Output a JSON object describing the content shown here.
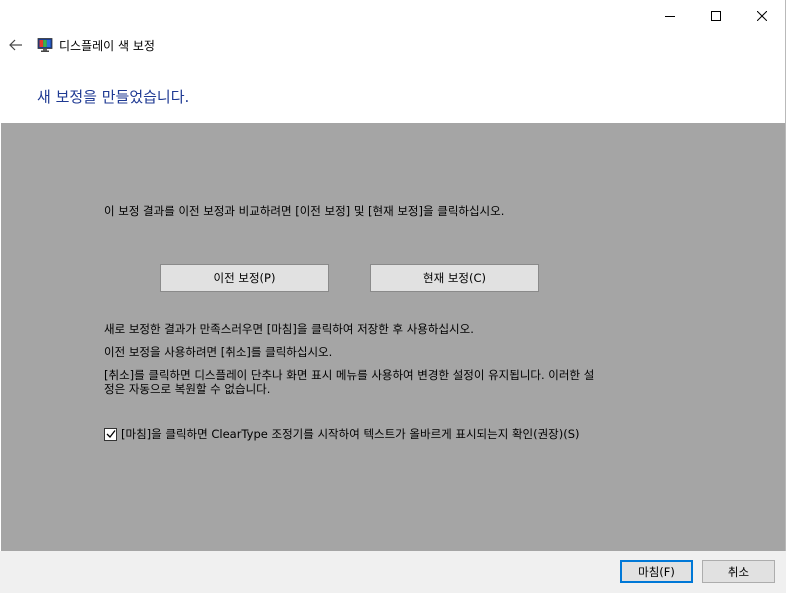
{
  "window": {
    "title": "디스플레이 색 보정",
    "icon": "monitor-color-icon"
  },
  "caption": {
    "minimize_icon": "minimize-icon",
    "maximize_icon": "maximize-icon",
    "close_icon": "close-icon"
  },
  "nav": {
    "back_icon": "back-arrow-icon"
  },
  "heading": "새 보정을 만들었습니다.",
  "panel": {
    "compare_text": "이 보정 결과를 이전 보정과 비교하려면 [이전 보정] 및 [현재 보정]을 클릭하십시오.",
    "previous_button": "이전 보정(P)",
    "current_button": "현재 보정(C)",
    "finish_text": "새로 보정한 결과가 만족스러우면 [마침]을 클릭하여 저장한 후 사용하십시오.",
    "cancel_text": "이전 보정을 사용하려면 [취소]를 클릭하십시오.",
    "warning_line1": "[취소]를 클릭하면 디스플레이 단추나 화면 표시 메뉴를 사용하여 변경한 설정이 유지됩니다. 이러한 설",
    "warning_line2": "정은 자동으로 복원할 수 없습니다.",
    "cleartype_checkbox_label": "[마침]을 클릭하면 ClearType 조정기를 시작하여 텍스트가 올바르게 표시되는지 확인(권장)(S)",
    "cleartype_checked": true
  },
  "footer": {
    "finish_button": "마침(F)",
    "cancel_button": "취소"
  },
  "colors": {
    "heading": "#1f3a93",
    "panel_background": "#a5a5a5",
    "footer_background": "#f0f0f0",
    "default_button_border": "#0078d7"
  }
}
